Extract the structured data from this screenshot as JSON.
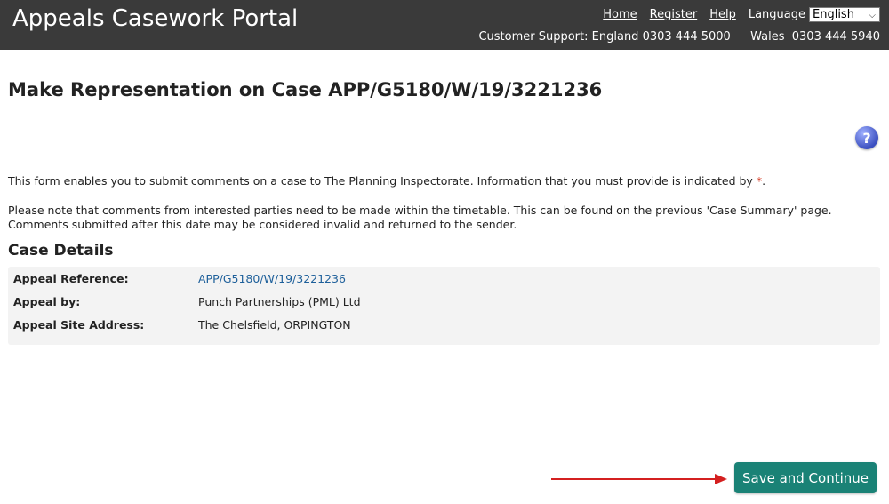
{
  "header": {
    "title": "Appeals Casework Portal",
    "links": {
      "home": "Home",
      "register": "Register",
      "help": "Help"
    },
    "language_label": "Language",
    "language_selected": "English",
    "support": {
      "prefix": "Customer Support:",
      "england_label": "England",
      "england_phone": "0303 444 5000",
      "wales_label": "Wales",
      "wales_phone": "0303 444 5940"
    }
  },
  "main": {
    "title": "Make Representation on Case APP/G5180/W/19/3221236",
    "help_glyph": "?",
    "intro_text": "This form enables you to submit comments on a case to The Planning Inspectorate. Information that you must provide is indicated by",
    "required_marker": "*",
    "intro_end": ".",
    "note_line1": "Please note that comments from interested parties need to be made within the timetable. This can be found on the previous 'Case Summary' page.",
    "note_line2": "Comments submitted after this date may be considered invalid and returned to the sender."
  },
  "case_details": {
    "heading": "Case Details",
    "rows": [
      {
        "label": "Appeal Reference:",
        "value": "APP/G5180/W/19/3221236"
      },
      {
        "label": "Appeal by:",
        "value": "Punch Partnerships (PML) Ltd"
      },
      {
        "label": "Appeal Site Address:",
        "value": "The Chelsfield, ORPINGTON"
      }
    ]
  },
  "actions": {
    "save_continue": "Save and Continue"
  },
  "colors": {
    "header_bg": "#3a3a3a",
    "button_bg": "#1a8276",
    "link": "#1d5f9a",
    "arrow": "#d42020",
    "required": "#d4351c"
  }
}
